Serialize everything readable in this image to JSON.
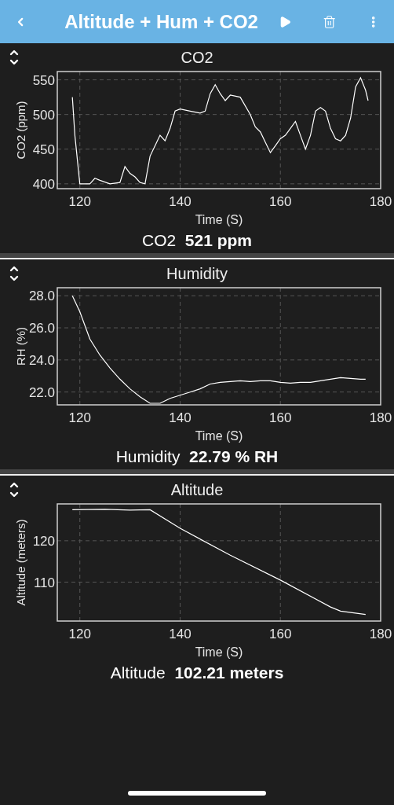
{
  "header": {
    "title": "Altitude + Hum + CO2"
  },
  "panels": [
    {
      "reading": "CO2  **521 ppm**",
      "chart_data": {
        "type": "line",
        "title": "CO2",
        "grid": true,
        "xlabel": "Time (S)",
        "ylabel": "CO2 (ppm)",
        "xlim": [
          115.5,
          180
        ],
        "ylim": [
          393,
          562
        ],
        "xticks": [
          120,
          140,
          160,
          180
        ],
        "yticks": [
          400,
          450,
          500,
          550
        ],
        "x": [
          118.5,
          119,
          120,
          122,
          123,
          124,
          126,
          128,
          129,
          130,
          131,
          132,
          133,
          134,
          135,
          136,
          137,
          138,
          139,
          140,
          142,
          144,
          145,
          146,
          147,
          148,
          149,
          150,
          152,
          154,
          155,
          156,
          157,
          158,
          159,
          160,
          161,
          162,
          163,
          164,
          165,
          166,
          167,
          168,
          169,
          170,
          171,
          172,
          173,
          174,
          175,
          176,
          177,
          177.5
        ],
        "series": [
          {
            "color": "#ffffff",
            "values": [
              525,
              470,
              400,
              400,
              408,
              405,
              400,
              402,
              425,
              415,
              410,
              402,
              400,
              440,
              455,
              470,
              462,
              480,
              505,
              508,
              505,
              502,
              505,
              530,
              543,
              530,
              520,
              528,
              525,
              500,
              482,
              475,
              460,
              445,
              455,
              465,
              470,
              480,
              490,
              470,
              450,
              470,
              505,
              510,
              505,
              480,
              465,
              462,
              470,
              495,
              540,
              553,
              535,
              520
            ]
          }
        ]
      }
    },
    {
      "reading": "Humidity  **22.79 % RH**",
      "chart_data": {
        "type": "line",
        "title": "Humidity",
        "grid": true,
        "xlabel": "Time (S)",
        "ylabel": "RH (%)",
        "xlim": [
          115.5,
          180
        ],
        "ylim": [
          21.2,
          28.5
        ],
        "xticks": [
          120,
          140,
          160,
          180
        ],
        "yticks": [
          {
            "value": 22,
            "label": "22.0"
          },
          {
            "value": 24,
            "label": "24.0"
          },
          {
            "value": 26,
            "label": "26.0"
          },
          {
            "value": 28,
            "label": "28.0"
          }
        ],
        "x": [
          118.5,
          120,
          122,
          124,
          126,
          128,
          130,
          132,
          134,
          136,
          138,
          140,
          142,
          144,
          146,
          148,
          150,
          152,
          154,
          156,
          158,
          160,
          162,
          164,
          166,
          168,
          170,
          172,
          174,
          176,
          177
        ],
        "series": [
          {
            "color": "#ffffff",
            "values": [
              28.0,
              27.0,
              25.3,
              24.3,
              23.5,
              22.8,
              22.2,
              21.7,
              21.3,
              21.3,
              21.6,
              21.8,
              22.0,
              22.2,
              22.5,
              22.6,
              22.65,
              22.7,
              22.65,
              22.7,
              22.7,
              22.6,
              22.55,
              22.6,
              22.6,
              22.7,
              22.8,
              22.9,
              22.85,
              22.8,
              22.8
            ]
          }
        ]
      }
    },
    {
      "reading": "Altitude  **102.21 meters**",
      "chart_data": {
        "type": "line",
        "title": "Altitude",
        "grid": true,
        "xlabel": "Time (S)",
        "ylabel": "Altitude (meters)",
        "xlim": [
          115.5,
          180
        ],
        "ylim": [
          100.6,
          128.9
        ],
        "xticks": [
          120,
          140,
          160,
          180
        ],
        "yticks": [
          110,
          120
        ],
        "x": [
          118.5,
          125,
          130,
          134,
          140,
          150,
          160,
          170,
          172,
          177
        ],
        "series": [
          {
            "color": "#ffffff",
            "values": [
              127.5,
              127.6,
              127.4,
              127.5,
              123,
              116.5,
              110.5,
              104,
              103,
              102.2
            ]
          }
        ]
      }
    }
  ]
}
